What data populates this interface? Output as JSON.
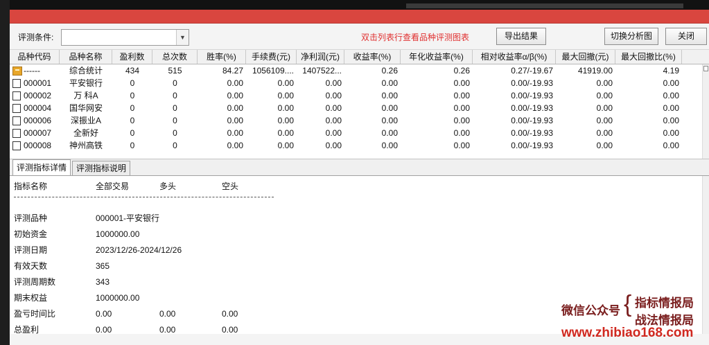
{
  "toolbar": {
    "condition_label": "评测条件:",
    "condition_value": "",
    "hint": "双击列表行查看品种评测图表",
    "export_label": "导出结果",
    "chart_label": "切换分析图",
    "close_label": "关闭"
  },
  "table": {
    "columns": [
      "品种代码",
      "品种名称",
      "盈利数",
      "总次数",
      "胜率(%)",
      "手续费(元)",
      "净利润(元)",
      "收益率(%)",
      "年化收益率(%)",
      "相对收益率α/β(%)",
      "最大回撤(元)",
      "最大回撤比(%)"
    ],
    "rows": [
      {
        "code": "------",
        "name": "综合统计",
        "win": "434",
        "total": "515",
        "rate": "84.27",
        "fee": "1056109....",
        "net": "1407522...",
        "ret": "0.26",
        "annual": "0.26",
        "rel": "0.27/-19.67",
        "dd": "41919.00",
        "ddr": "4.19",
        "icon": "folder"
      },
      {
        "code": "000001",
        "name": "平安银行",
        "win": "0",
        "total": "0",
        "rate": "0.00",
        "fee": "0.00",
        "net": "0.00",
        "ret": "0.00",
        "annual": "0.00",
        "rel": "0.00/-19.93",
        "dd": "0.00",
        "ddr": "0.00",
        "icon": "doc"
      },
      {
        "code": "000002",
        "name": "万 科A",
        "win": "0",
        "total": "0",
        "rate": "0.00",
        "fee": "0.00",
        "net": "0.00",
        "ret": "0.00",
        "annual": "0.00",
        "rel": "0.00/-19.93",
        "dd": "0.00",
        "ddr": "0.00",
        "icon": "doc"
      },
      {
        "code": "000004",
        "name": "国华网安",
        "win": "0",
        "total": "0",
        "rate": "0.00",
        "fee": "0.00",
        "net": "0.00",
        "ret": "0.00",
        "annual": "0.00",
        "rel": "0.00/-19.93",
        "dd": "0.00",
        "ddr": "0.00",
        "icon": "doc"
      },
      {
        "code": "000006",
        "name": "深振业A",
        "win": "0",
        "total": "0",
        "rate": "0.00",
        "fee": "0.00",
        "net": "0.00",
        "ret": "0.00",
        "annual": "0.00",
        "rel": "0.00/-19.93",
        "dd": "0.00",
        "ddr": "0.00",
        "icon": "doc"
      },
      {
        "code": "000007",
        "name": "全新好",
        "win": "0",
        "total": "0",
        "rate": "0.00",
        "fee": "0.00",
        "net": "0.00",
        "ret": "0.00",
        "annual": "0.00",
        "rel": "0.00/-19.93",
        "dd": "0.00",
        "ddr": "0.00",
        "icon": "doc"
      },
      {
        "code": "000008",
        "name": "神州高铁",
        "win": "0",
        "total": "0",
        "rate": "0.00",
        "fee": "0.00",
        "net": "0.00",
        "ret": "0.00",
        "annual": "0.00",
        "rel": "0.00/-19.93",
        "dd": "0.00",
        "ddr": "0.00",
        "icon": "doc"
      }
    ]
  },
  "tabs": [
    "评测指标详情",
    "评测指标说明"
  ],
  "detail": {
    "header": [
      "指标名称",
      "全部交易",
      "多头",
      "空头"
    ],
    "rows": [
      {
        "label": "评测品种",
        "v1": "000001-平安银行",
        "v2": "",
        "v3": ""
      },
      {
        "label": "初始资金",
        "v1": "1000000.00",
        "v2": "",
        "v3": ""
      },
      {
        "label": "评测日期",
        "v1": "2023/12/26-2024/12/26",
        "v2": "",
        "v3": ""
      },
      {
        "label": "有效天数",
        "v1": "365",
        "v2": "",
        "v3": ""
      },
      {
        "label": "评测周期数",
        "v1": "343",
        "v2": "",
        "v3": ""
      },
      {
        "label": "期末权益",
        "v1": "1000000.00",
        "v2": "",
        "v3": ""
      },
      {
        "label": "盈亏时间比",
        "v1": "0.00",
        "v2": "0.00",
        "v3": "0.00"
      },
      {
        "label": "总盈利",
        "v1": "0.00",
        "v2": "0.00",
        "v3": "0.00"
      }
    ]
  },
  "watermark": {
    "wechat": "微信公众号",
    "line1": "指标情报局",
    "line2": "战法情报局",
    "url": "www.zhibiao168.com"
  }
}
